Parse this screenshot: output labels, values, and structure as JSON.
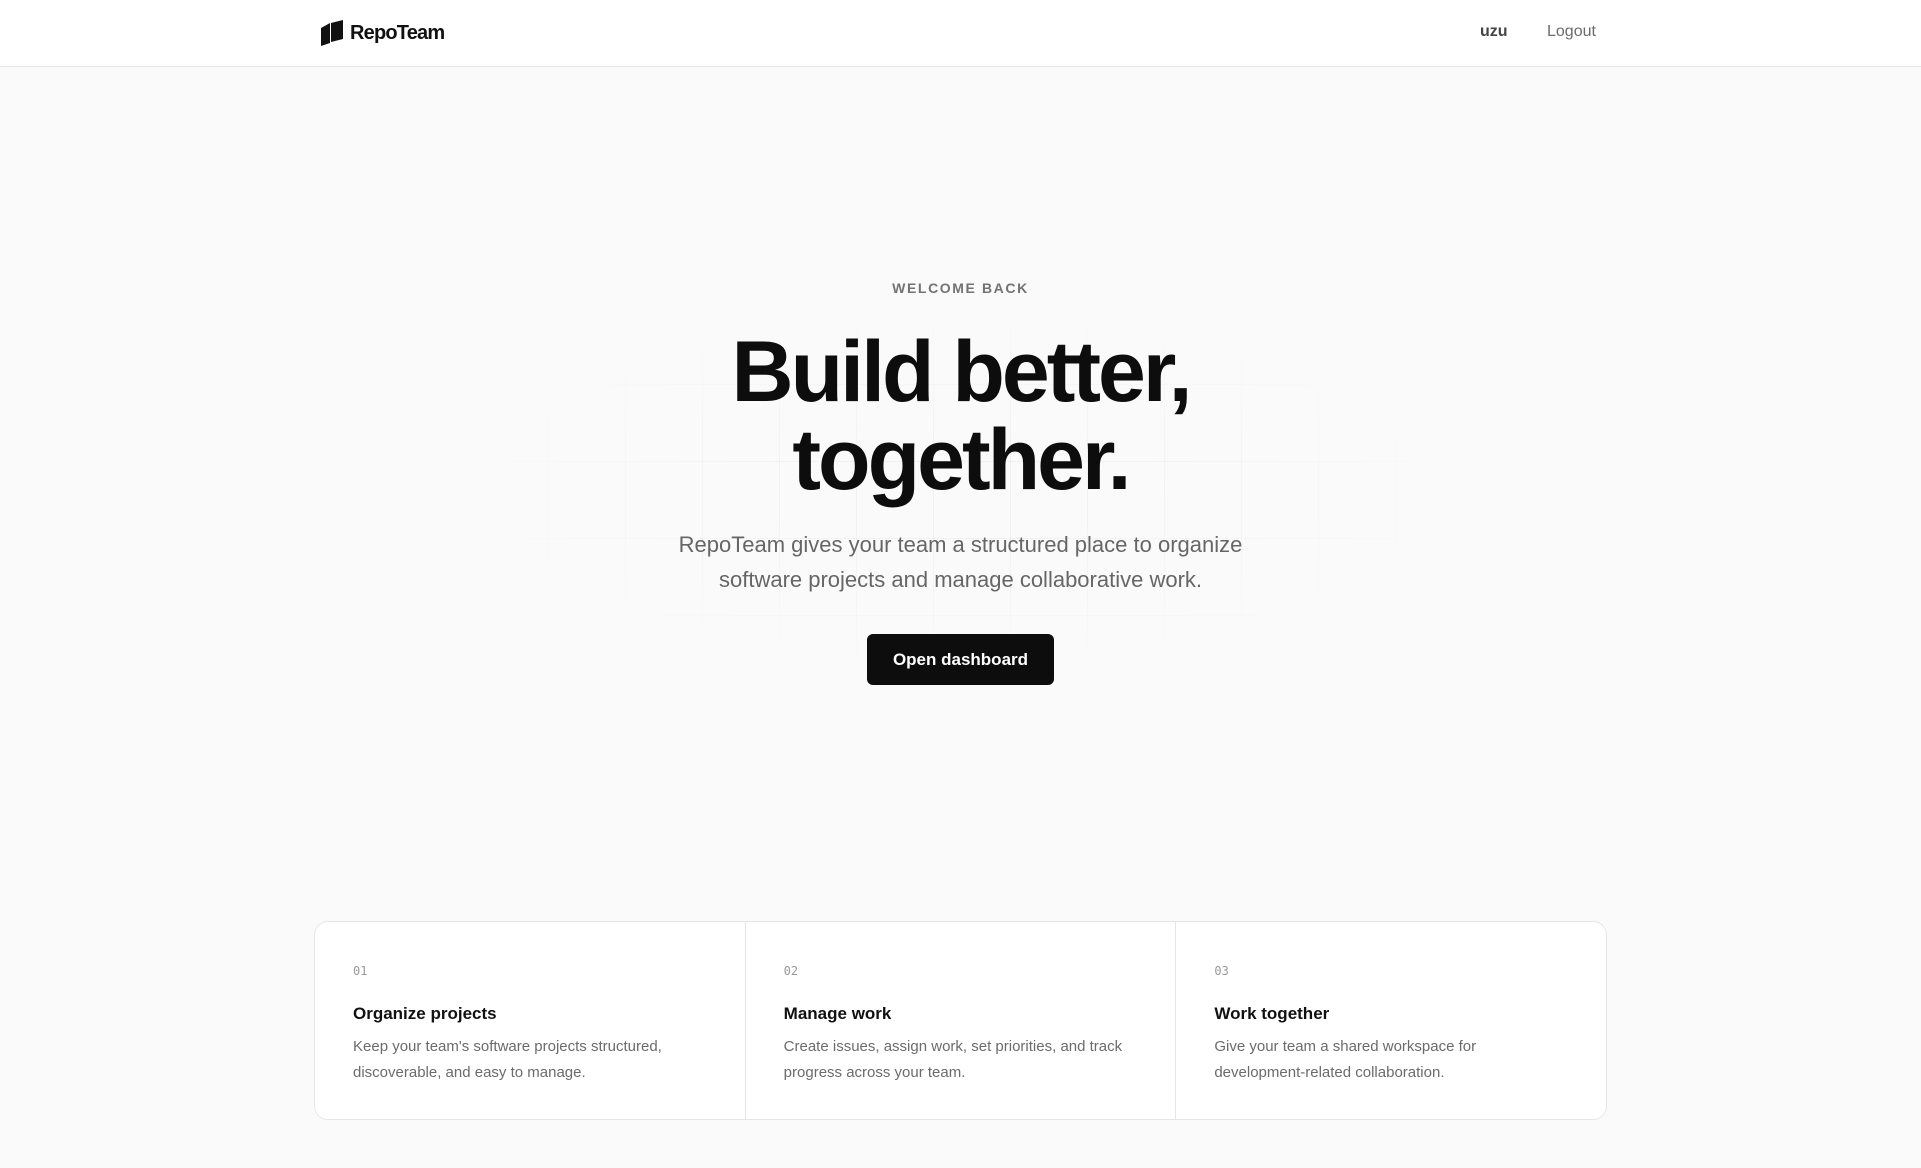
{
  "header": {
    "brand": "RepoTeam",
    "brand_icon": "repoteam-logo-icon",
    "user": "uzu",
    "logout_label": "Logout"
  },
  "hero": {
    "eyebrow": "WELCOME BACK",
    "headline_line1": "Build better,",
    "headline_line2": "together.",
    "subtext": "RepoTeam gives your team a structured place to organize software projects and manage collaborative work.",
    "cta_label": "Open dashboard"
  },
  "features": [
    {
      "num": "01",
      "title": "Organize projects",
      "desc": "Keep your team's software projects structured, discoverable, and easy to manage."
    },
    {
      "num": "02",
      "title": "Manage work",
      "desc": "Create issues, assign work, set priorities, and track progress across your team."
    },
    {
      "num": "03",
      "title": "Work together",
      "desc": "Give your team a shared workspace for development-related collaboration."
    }
  ],
  "colors": {
    "background": "#fafafa",
    "surface": "#ffffff",
    "text_primary": "#0d0d0d",
    "text_muted": "#6b6b6b",
    "border": "#e6e6e6",
    "button_bg": "#0d0d0d"
  }
}
